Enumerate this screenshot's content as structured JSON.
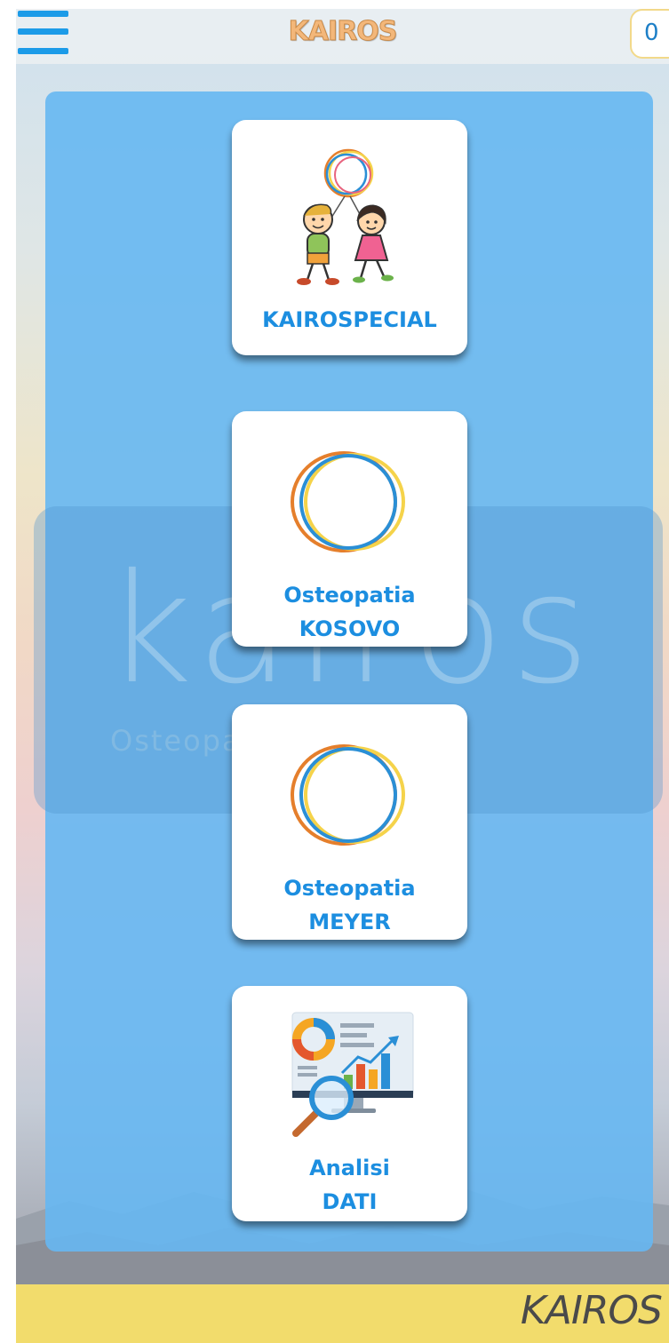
{
  "header": {
    "title": "KAIROS",
    "counter": "0",
    "menu_icon": "hamburger-menu-icon"
  },
  "watermark": {
    "word": "kairos",
    "subtitle": "Osteopatia integrate"
  },
  "cards": [
    {
      "id": "kairospecial",
      "lines": [
        "KAIROSPECIAL"
      ],
      "icon": "children-balloon-icon"
    },
    {
      "id": "osteopatia-kosovo",
      "lines": [
        "Osteopatia",
        "KOSOVO"
      ],
      "icon": "kairos-rings-logo-icon"
    },
    {
      "id": "osteopatia-meyer",
      "lines": [
        "Osteopatia",
        "MEYER"
      ],
      "icon": "kairos-rings-logo-icon"
    },
    {
      "id": "analisi-dati",
      "lines": [
        "Analisi",
        "DATI"
      ],
      "icon": "data-analytics-icon"
    }
  ],
  "footer": {
    "brand": "KAIROS"
  },
  "colors": {
    "accent": "#1c9be8",
    "label": "#1c8ee0",
    "panel": "#66b7f2",
    "footer": "#f2dc6c",
    "title": "#f3b77a"
  }
}
